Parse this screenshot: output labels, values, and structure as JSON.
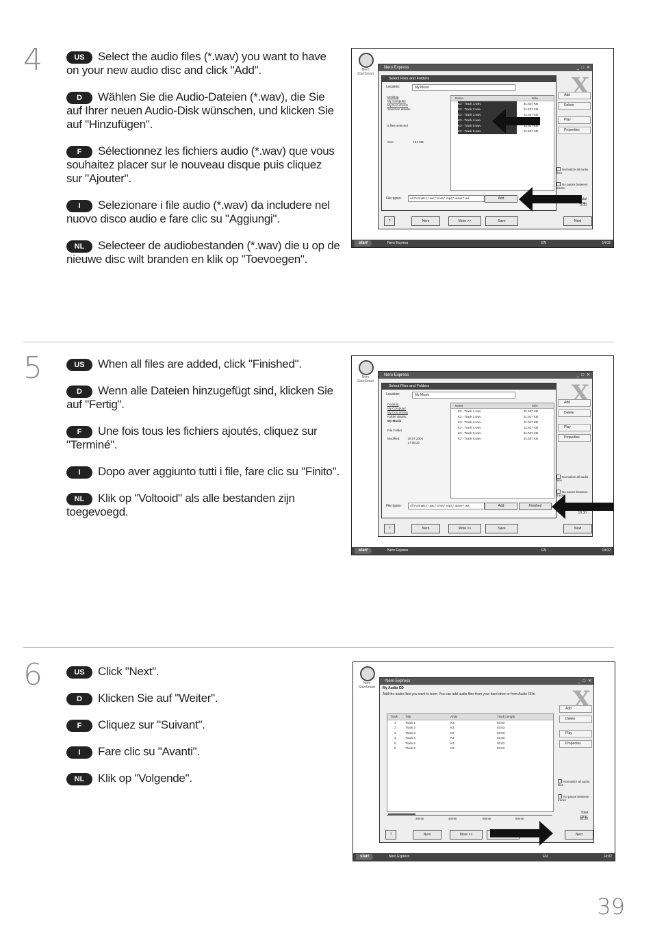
{
  "steps": [
    {
      "number": "4",
      "instructions": [
        {
          "lang": "US",
          "text": "Select the audio files (*.wav) you want to have on your new audio disc and click \"Add\"."
        },
        {
          "lang": "D",
          "text": "Wählen Sie die Audio-Dateien (*.wav), die Sie auf Ihrer neuen Audio-Disk wünschen, und klicken Sie auf \"Hinzufügen\"."
        },
        {
          "lang": "F",
          "text": "Sélectionnez les fichiers audio (*.wav) que vous souhaitez placer sur le nouveau disque puis cliquez sur \"Ajouter\"."
        },
        {
          "lang": "I",
          "text": "Selezionare i file audio (*.wav) da includere nel nuovo disco audio e fare clic su \"Aggiungi\"."
        },
        {
          "lang": "NL",
          "text": "Selecteer de audiobestanden (*.wav) die u op de nieuwe disc wilt branden en klik op \"Toevoegen\"."
        }
      ]
    },
    {
      "number": "5",
      "instructions": [
        {
          "lang": "US",
          "text": "When all files are added, click \"Finished\"."
        },
        {
          "lang": "D",
          "text": "Wenn alle Dateien hinzugefügt sind, klicken Sie auf \"Fertig\"."
        },
        {
          "lang": "F",
          "text": "Une fois tous les fichiers ajoutés, cliquez sur \"Terminé\"."
        },
        {
          "lang": "I",
          "text": "Dopo aver aggiunto tutti i file, fare clic su \"Finito\"."
        },
        {
          "lang": "NL",
          "text": "Klik op \"Voltooid\" als alle bestanden zijn toegevoegd."
        }
      ]
    },
    {
      "number": "6",
      "instructions": [
        {
          "lang": "US",
          "text": "Click \"Next\"."
        },
        {
          "lang": "D",
          "text": "Klicken Sie auf \"Weiter\"."
        },
        {
          "lang": "F",
          "text": "Cliquez sur \"Suivant\"."
        },
        {
          "lang": "I",
          "text": "Fare clic su \"Avanti\"."
        },
        {
          "lang": "NL",
          "text": "Klik op \"Volgende\"."
        }
      ]
    }
  ],
  "screen": {
    "desktop_icon_label": "Nero StartSmart",
    "app_title": "Nero Express",
    "dialog_title": "Select Files and Folders",
    "location_label": "Location:",
    "location_value": "My Music",
    "left_links": [
      "Desktop",
      "My Computer",
      "My Documents"
    ],
    "selection_details": "Selection details:",
    "files_selected": "6 files selected",
    "size_label": "Size:",
    "size_value": "184 MB",
    "folder_details": "Folder details:",
    "folder_name": "My Music",
    "file_folder": "File Folder",
    "modified_label": "Modified:",
    "modified_value": "19.07.2004 17:06:20",
    "col_name": "Name",
    "col_size": "Size",
    "files": [
      {
        "name": "K3 - Track 1.wav",
        "size": "31.537 KB"
      },
      {
        "name": "K3 - Track 2.wav",
        "size": "31.537 KB"
      },
      {
        "name": "K3 - Track 3.wav",
        "size": "31.537 KB"
      },
      {
        "name": "K3 - Track 4.wav",
        "size": "31.537 KB"
      },
      {
        "name": "K3 - Track 5.wav",
        "size": "31.537 KB"
      },
      {
        "name": "K3 - Track 6.wav",
        "size": "31.537 KB"
      }
    ],
    "file_types_label": "File types:",
    "file_types_value": "All Formats (*.aac;*.m4a;*.mp4;*.wave;*.wa",
    "add_button": "Add",
    "finished_button": "Finished",
    "side_add": "Add",
    "side_delete": "Delete",
    "side_play": "Play",
    "side_properties": "Properties",
    "normalize": "Normalize all audio files",
    "no_pause": "No pause between tracks",
    "total_time_label": "Total time:",
    "total_time_4": "0.00",
    "total_time_5": "18:30",
    "total_time_6": "18:30",
    "help_button": "?",
    "nero_button": "Nero",
    "more_button": "More >>",
    "save_button": "Save",
    "next_button": "Next",
    "start": "start",
    "taskbar_task": "Nero Express",
    "lang_indicator": "EN",
    "clock": "14:02",
    "audio_cd_title": "My Audio CD",
    "audio_cd_subtitle": "Add the audio files you want to burn. You can add audio files from your hard drive or from Audio CDs.",
    "track_cols": [
      "Track",
      "Title",
      "Artist",
      "Track Length"
    ],
    "tracks": [
      {
        "track": "1",
        "title": "Track 1",
        "artist": "K3",
        "length": "03:03"
      },
      {
        "track": "2",
        "title": "Track 2",
        "artist": "K3",
        "length": "03:03"
      },
      {
        "track": "3",
        "title": "Track 3",
        "artist": "K3",
        "length": "03:03"
      },
      {
        "track": "4",
        "title": "Track 4",
        "artist": "K3",
        "length": "03:03"
      },
      {
        "track": "5",
        "title": "Track 5",
        "artist": "K3",
        "length": "03:03"
      },
      {
        "track": "6",
        "title": "Track 6",
        "artist": "K3",
        "length": "03:03"
      }
    ],
    "ruler_marks": [
      "20min",
      "40min",
      "60min",
      "80min"
    ]
  },
  "page_number": "39"
}
